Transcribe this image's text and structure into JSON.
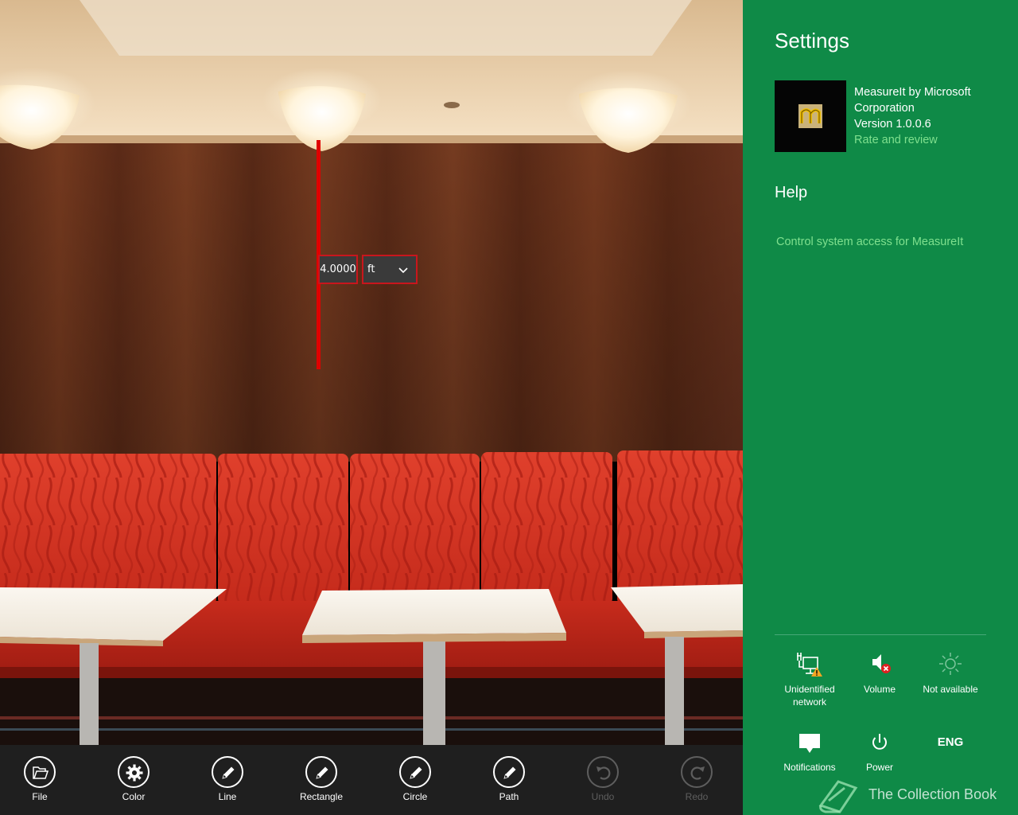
{
  "measurement": {
    "value": "4.0000",
    "unit": "ft"
  },
  "appbar": {
    "buttons": [
      {
        "label": "File",
        "icon": "folder-icon",
        "enabled": true
      },
      {
        "label": "Color",
        "icon": "gear-icon",
        "enabled": true
      },
      {
        "label": "Line",
        "icon": "pencil-icon",
        "enabled": true
      },
      {
        "label": "Rectangle",
        "icon": "pencil-icon",
        "enabled": true
      },
      {
        "label": "Circle",
        "icon": "pencil-icon",
        "enabled": true
      },
      {
        "label": "Path",
        "icon": "pencil-icon",
        "enabled": true
      },
      {
        "label": "Undo",
        "icon": "undo-icon",
        "enabled": false
      },
      {
        "label": "Redo",
        "icon": "redo-icon",
        "enabled": false
      }
    ]
  },
  "settings": {
    "title": "Settings",
    "app_line1": "MeasureIt by Microsoft",
    "app_line2": "Corporation",
    "version": "Version 1.0.0.6",
    "rate": "Rate and review",
    "help_heading": "Help",
    "help_link": "Control system access for MeasureIt"
  },
  "tray": {
    "network_line1": "Unidentified",
    "network_line2": "network",
    "volume": "Volume",
    "brightness": "Not available",
    "notifications": "Notifications",
    "power": "Power",
    "language": "ENG"
  },
  "watermark": "The Collection Book",
  "colors": {
    "charm_background": "#0f8a47",
    "link_green": "#7fe08e",
    "measure_red": "#e00000",
    "appbar_background": "#1f1f1f"
  }
}
